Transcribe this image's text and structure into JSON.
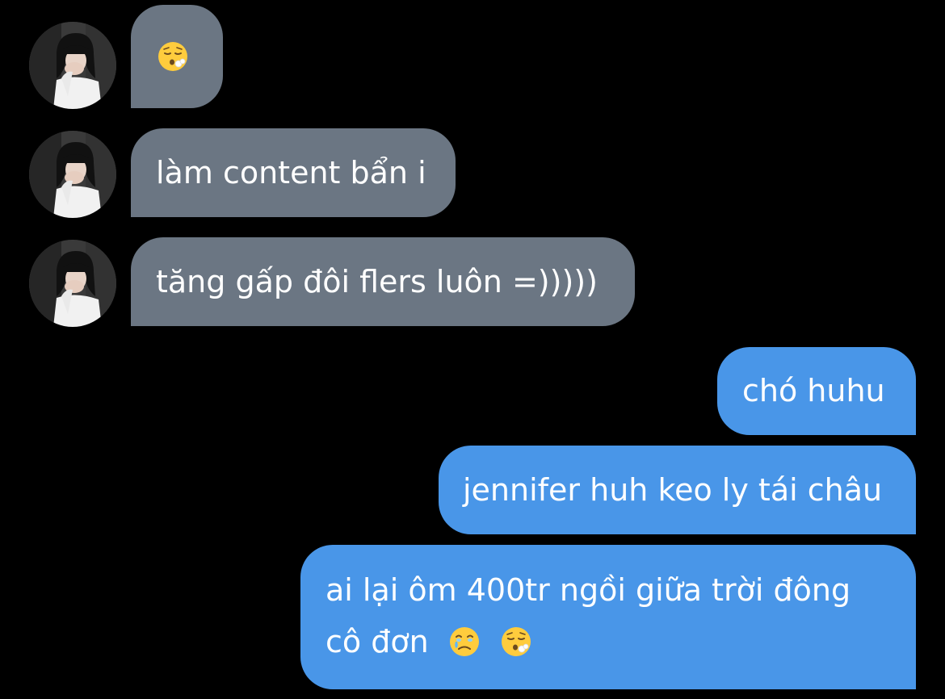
{
  "colors": {
    "background": "#000000",
    "incoming_bubble": "#6b7683",
    "outgoing_bubble": "#4996e8",
    "text": "#ffffff"
  },
  "conversation": {
    "incoming": [
      {
        "text": "",
        "emojis": [
          "face-exhaling-emoji"
        ]
      },
      {
        "text": "làm content bẩn i"
      },
      {
        "text": "tăng gấp đôi flers luôn =)))))"
      }
    ],
    "outgoing": [
      {
        "text": "chó huhu"
      },
      {
        "text": "jennifer huh keo ly tái châu"
      },
      {
        "lines": [
          "ai lại ôm 400tr ngồi giữa trời đông",
          "cô đơn"
        ],
        "emojis": [
          "face-holding-back-tears-emoji",
          "face-exhaling-emoji"
        ]
      }
    ]
  }
}
